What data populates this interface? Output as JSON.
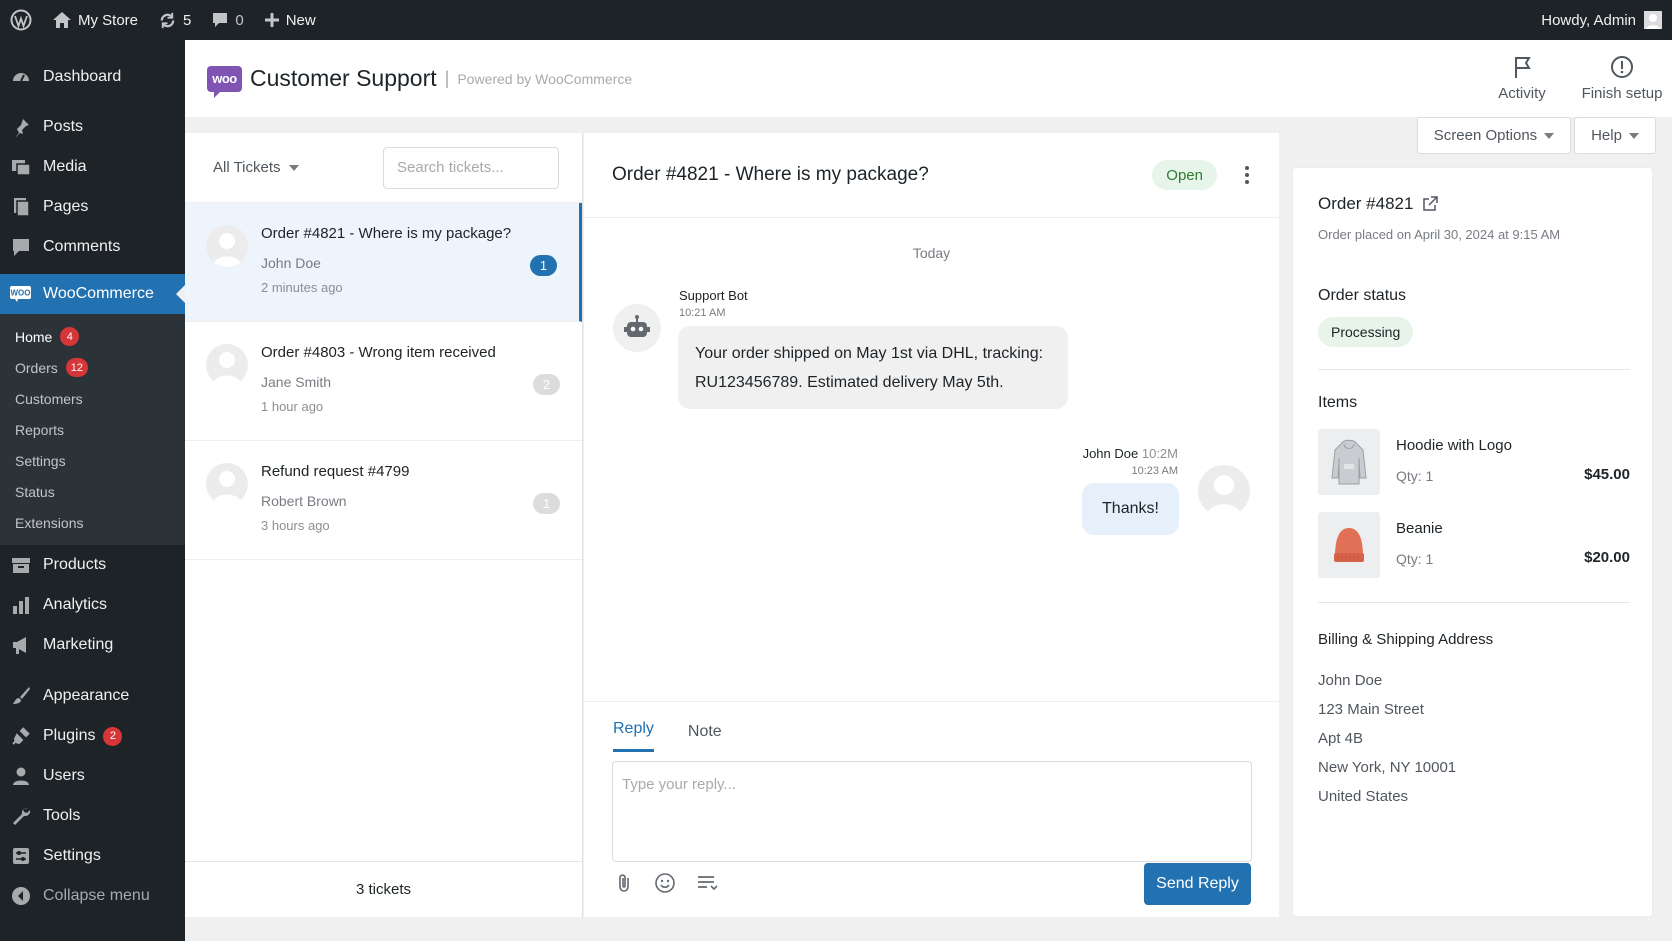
{
  "admin_bar": {
    "site_name": "My Store",
    "updates_count": "5",
    "comments_count": "0",
    "new_label": "New",
    "greeting": "Howdy, Admin"
  },
  "sidebar": {
    "items": [
      {
        "label": "Dashboard",
        "icon": "dashboard-icon"
      },
      {
        "label": "Posts",
        "icon": "pin-icon"
      },
      {
        "label": "Media",
        "icon": "media-icon"
      },
      {
        "label": "Pages",
        "icon": "pages-icon"
      },
      {
        "label": "Comments",
        "icon": "comment-icon"
      },
      {
        "label": "WooCommerce",
        "icon": "woo-icon"
      },
      {
        "label": "Products",
        "icon": "archive-icon"
      },
      {
        "label": "Analytics",
        "icon": "bar-chart-icon"
      },
      {
        "label": "Marketing",
        "icon": "megaphone-icon"
      },
      {
        "label": "Appearance",
        "icon": "brush-icon"
      },
      {
        "label": "Plugins",
        "icon": "plug-icon",
        "badge": "2"
      },
      {
        "label": "Users",
        "icon": "user-icon"
      },
      {
        "label": "Tools",
        "icon": "wrench-icon"
      },
      {
        "label": "Settings",
        "icon": "settings-icon"
      },
      {
        "label": "Collapse menu",
        "icon": "collapse-icon"
      }
    ],
    "woo_submenu": [
      {
        "label": "Home",
        "badge": "4"
      },
      {
        "label": "Orders",
        "badge": "12"
      },
      {
        "label": "Customers"
      },
      {
        "label": "Reports"
      },
      {
        "label": "Settings"
      },
      {
        "label": "Status"
      },
      {
        "label": "Extensions"
      }
    ]
  },
  "header": {
    "logo_text": "woo",
    "title": "Customer Support",
    "separator": "|",
    "powered_by": "Powered by WooCommerce",
    "actions": [
      {
        "label": "Activity",
        "icon": "flag-icon"
      },
      {
        "label": "Finish setup",
        "icon": "info-icon"
      }
    ]
  },
  "screen_options_label": "Screen Options",
  "help_label": "Help",
  "ticket_list": {
    "filter_label": "All Tickets",
    "search_placeholder": "Search tickets...",
    "tickets": [
      {
        "title": "Order #4821 - Where is my package?",
        "customer": "John Doe",
        "time": "2 minutes ago",
        "count": "1",
        "selected": true
      },
      {
        "title": "Order #4803 - Wrong item received",
        "customer": "Jane Smith",
        "time": "1 hour ago",
        "count": "2",
        "selected": false
      },
      {
        "title": "Refund request #4799",
        "customer": "Robert Brown",
        "time": "3 hours ago",
        "count": "1",
        "selected": false
      }
    ],
    "footer": "3 tickets"
  },
  "conversation": {
    "title": "Order #4821 - Where is my package?",
    "status": "Open",
    "day_divider": "Today",
    "messages": [
      {
        "sender": "Support Bot",
        "time": "10:21 AM",
        "text": "Your order shipped on May 1st via DHL, tracking: RU123456789. Estimated delivery May 5th."
      },
      {
        "sender": "John Doe",
        "sender_extra": "10:2M",
        "time": "10:23 AM",
        "text": "Thanks!"
      }
    ],
    "tabs": [
      "Reply",
      "Note"
    ],
    "reply_placeholder": "Type your reply...",
    "send_label": "Send Reply"
  },
  "order": {
    "title": "Order #4821",
    "placed": "Order placed on April 30, 2024 at 9:15 AM",
    "status_heading": "Order status",
    "status": "Processing",
    "items_heading": "Items",
    "items": [
      {
        "name": "Hoodie with Logo",
        "qty": "Qty: 1",
        "price": "$45.00"
      },
      {
        "name": "Beanie",
        "qty": "Qty: 1",
        "price": "$20.00"
      }
    ],
    "address_heading": "Billing & Shipping Address",
    "address": [
      "John Doe",
      "123 Main Street",
      "Apt 4B",
      "New York, NY 10001",
      "United States"
    ]
  },
  "colors": {
    "accent": "#2271b1",
    "admin_dark": "#1d2327",
    "badge_red": "#d63638",
    "status_green_bg": "#e6f4ea",
    "woo_purple": "#7f54b3"
  }
}
